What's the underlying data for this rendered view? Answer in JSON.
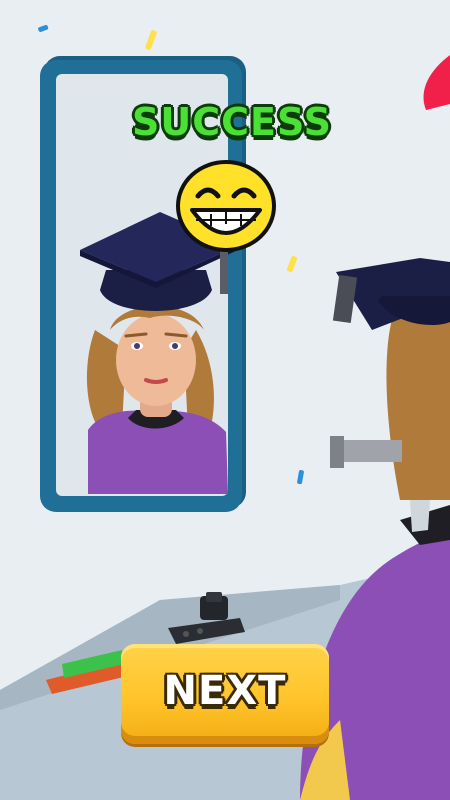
{
  "banner": {
    "result_text": "SUCCESS"
  },
  "result_emoji": {
    "icon": "grinning-face-icon"
  },
  "actions": {
    "next_label": "NEXT"
  },
  "colors": {
    "background": "#e9eef3",
    "mirror_frame": "#1f6f96",
    "success_text": "#4be036",
    "next_button": "#ffc42a",
    "gown": "#8b4fb5",
    "cap": "#1c1f45"
  }
}
